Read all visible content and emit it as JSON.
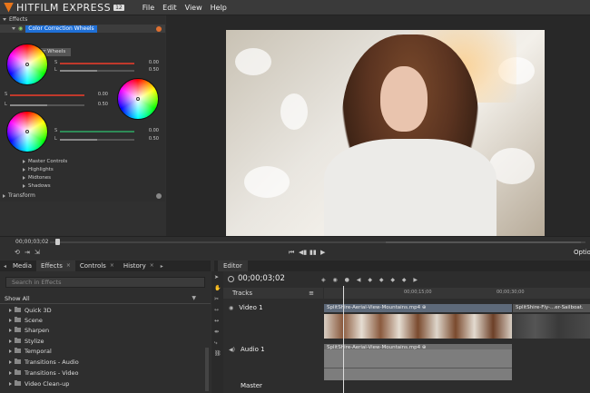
{
  "app": {
    "name": "HITFILM EXPRESS",
    "version": "12"
  },
  "menu": [
    "File",
    "Edit",
    "View",
    "Help"
  ],
  "controls": {
    "effects_label": "Effects",
    "effect_name": "Color Correction Wheels",
    "tab_label": "Color Wheels",
    "sliders": [
      {
        "label": "S",
        "value": "0.00",
        "color": "#c0392b"
      },
      {
        "label": "L",
        "value": "0.50",
        "color": "#888888"
      },
      {
        "label": "S",
        "value": "0.00",
        "color": "#c0392b"
      },
      {
        "label": "L",
        "value": "0.50",
        "color": "#888888"
      },
      {
        "label": "S",
        "value": "0.00",
        "color": "#2e8b57"
      },
      {
        "label": "L",
        "value": "0.50",
        "color": "#888888"
      }
    ],
    "sub_items": [
      "Master Controls",
      "Highlights",
      "Midtones",
      "Shadows"
    ],
    "transform_label": "Transform"
  },
  "viewer": {
    "timecode": "00;00;03;02",
    "options_label": "Optio"
  },
  "left_tabs": [
    {
      "label": "Media",
      "close": ""
    },
    {
      "label": "Effects",
      "close": "×"
    },
    {
      "label": "Controls",
      "close": "×"
    },
    {
      "label": "History",
      "close": "×"
    }
  ],
  "effects_panel": {
    "search_placeholder": "Search in Effects",
    "show_all": "Show All",
    "folders": [
      "Quick 3D",
      "Scene",
      "Sharpen",
      "Stylize",
      "Temporal",
      "Transitions - Audio",
      "Transitions - Video",
      "Video Clean-up"
    ]
  },
  "editor": {
    "tab": "Editor",
    "timecode": "00;00;03;02",
    "tracks_label": "Tracks",
    "ruler": [
      "00;00;15;00",
      "00;00;30;00"
    ],
    "video_track": "Video 1",
    "audio_track": "Audio 1",
    "master": "Master",
    "clips": {
      "video1": "SplitShire-Aerial-View-Mountains.mp4 ⊕",
      "video2": "SplitShire-Fly-...er-Sailboat.",
      "audio1": "SplitShire-Aerial-View-Mountains.mp4 ⊕"
    }
  }
}
